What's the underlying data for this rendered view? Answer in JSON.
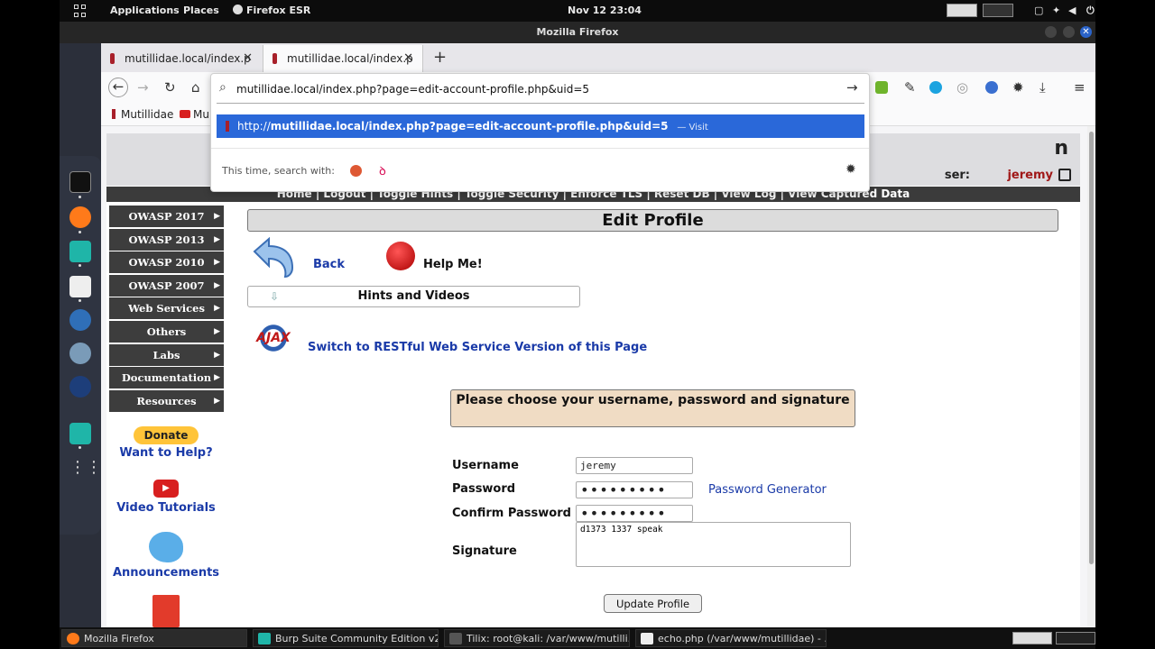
{
  "topbar": {
    "applications": "Applications",
    "places": "Places",
    "app_name": "Firefox ESR",
    "datetime": "Nov 12  23:04"
  },
  "window": {
    "title": "Mozilla Firefox"
  },
  "tabs": [
    {
      "label": "mutillidae.local/index.p"
    },
    {
      "label": "mutillidae.local/index.p"
    }
  ],
  "url": {
    "value": "mutillidae.local/index.php?page=edit-account-profile.php&uid=5",
    "suggestion_prefix": "http://",
    "suggestion_bold": "mutillidae.local/index.php?page=edit-account-profile.php&uid=5",
    "suggestion_action": "— Visit",
    "search_with": "This time, search with:"
  },
  "bookmarks": [
    {
      "label": "Mutillidae"
    },
    {
      "label": "Mu"
    }
  ],
  "header": {
    "title_tail": "n",
    "user_prefix": "ser:",
    "username": "jeremy"
  },
  "menubar": {
    "text": "Home | Logout | Toggle Hints | Toggle Security | Enforce TLS | Reset DB | View Log | View Captured Data"
  },
  "leftnav": [
    {
      "label": "OWASP 2017"
    },
    {
      "label": "OWASP 2013"
    },
    {
      "label": "OWASP 2010"
    },
    {
      "label": "OWASP 2007"
    },
    {
      "label": "Web Services"
    },
    {
      "label": "Others"
    },
    {
      "label": "Labs"
    },
    {
      "label": "Documentation"
    },
    {
      "label": "Resources"
    }
  ],
  "sidebar": {
    "donate": "Donate",
    "want_help": "Want to Help?",
    "video_tutorials": "Video Tutorials",
    "announcements": "Announcements"
  },
  "main": {
    "title": "Edit Profile",
    "back": "Back",
    "help": "Help Me!",
    "hints": "Hints and Videos",
    "ajax_text": "AJAX",
    "restful_link": "Switch to RESTful Web Service Version of this Page"
  },
  "form": {
    "heading": "Please choose your username, password and signature",
    "username_label": "Username",
    "username_value": "jeremy",
    "password_label": "Password",
    "password_value": "•••••••••",
    "password_generator": "Password Generator",
    "confirm_label": "Confirm Password",
    "confirm_value": "•••••••••",
    "signature_label": "Signature",
    "signature_value": "d1373 1337 speak",
    "update_button": "Update Profile"
  },
  "taskbar": [
    {
      "label": "Mozilla Firefox"
    },
    {
      "label": "Burp Suite Community Edition v2..."
    },
    {
      "label": "Tilix: root@kali: /var/www/mutilli..."
    },
    {
      "label": "echo.php (/var/www/mutillidae) - ..."
    }
  ],
  "colors": {
    "link_blue": "#1a3aa8",
    "suggest_blue": "#2a68d9",
    "username_red": "#a01818",
    "nav_dark": "#3d3d3d",
    "form_head_bg": "#f0dcc4"
  }
}
